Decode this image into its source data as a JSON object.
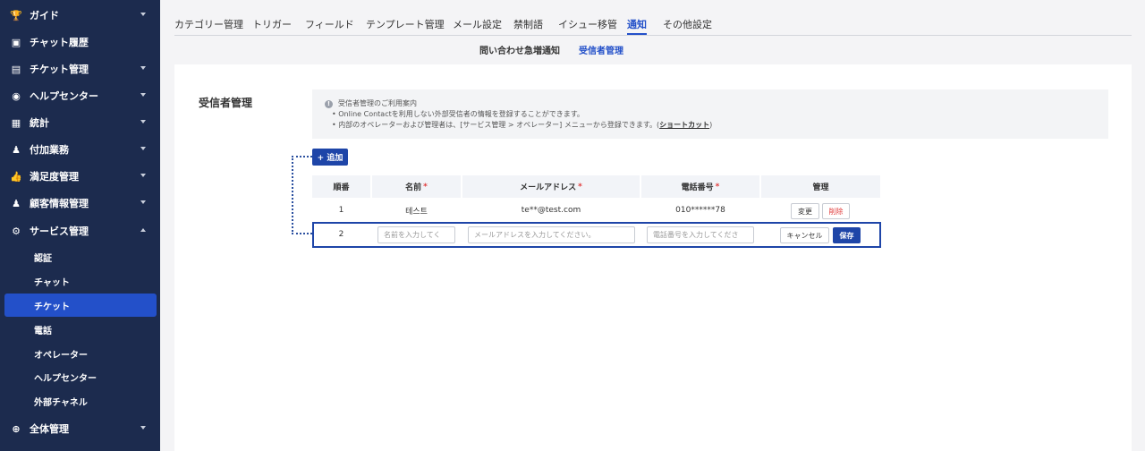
{
  "sidebar": {
    "items": [
      {
        "label": "ガイド",
        "icon": "trophy-icon"
      },
      {
        "label": "チャット履歴",
        "icon": "chat-icon"
      },
      {
        "label": "チケット管理",
        "icon": "document-icon"
      },
      {
        "label": "ヘルプセンター",
        "icon": "headset-icon"
      },
      {
        "label": "統計",
        "icon": "chart-icon"
      },
      {
        "label": "付加業務",
        "icon": "user-gear-icon"
      },
      {
        "label": "満足度管理",
        "icon": "thumbs-up-icon"
      },
      {
        "label": "顧客情報管理",
        "icon": "user-icon"
      },
      {
        "label": "サービス管理",
        "icon": "gear-icon"
      },
      {
        "label": "全体管理",
        "icon": "plus-circle-icon"
      }
    ],
    "sub_items": [
      "認証",
      "チャット",
      "チケット",
      "電話",
      "オペレーター",
      "ヘルプセンター",
      "外部チャネル"
    ]
  },
  "tabs": [
    "カテゴリー管理",
    "トリガー",
    "フィールド",
    "テンプレート管理",
    "メール設定",
    "禁制語",
    "イシュー移管",
    "通知",
    "その他設定"
  ],
  "subtabs": [
    "問い合わせ急増通知",
    "受信者管理"
  ],
  "panel": {
    "title": "受信者管理",
    "notice": {
      "heading": "受信者管理のご利用案内",
      "line1": "• Online Contactを利用しない外部受信者の情報を登録することができます。",
      "line2_prefix": "• 内部のオペレーターおよび管理者は、[サービス管理 > オペレーター] メニューから登録できます。(",
      "line2_link": "ショートカット",
      "line2_suffix": ")"
    },
    "add_button": "+ 追加"
  },
  "table": {
    "headers": {
      "order": "順番",
      "name": "名前",
      "email": "メールアドレス",
      "phone": "電話番号",
      "manage": "管理"
    },
    "required_mark": "*",
    "row1": {
      "order": "1",
      "name": "테스트",
      "email": "te**@test.com",
      "phone": "010******78",
      "edit": "変更",
      "delete": "削除"
    },
    "row2": {
      "order": "2",
      "name_placeholder": "名前を入力してく",
      "email_placeholder": "メールアドレスを入力してください。",
      "phone_placeholder": "電話番号を入力してくださ",
      "cancel": "キャンセル",
      "save": "保存"
    }
  },
  "colors": {
    "sidebar_bg": "#1c2b4e",
    "accent": "#2350c9",
    "danger": "#e03a3a"
  }
}
